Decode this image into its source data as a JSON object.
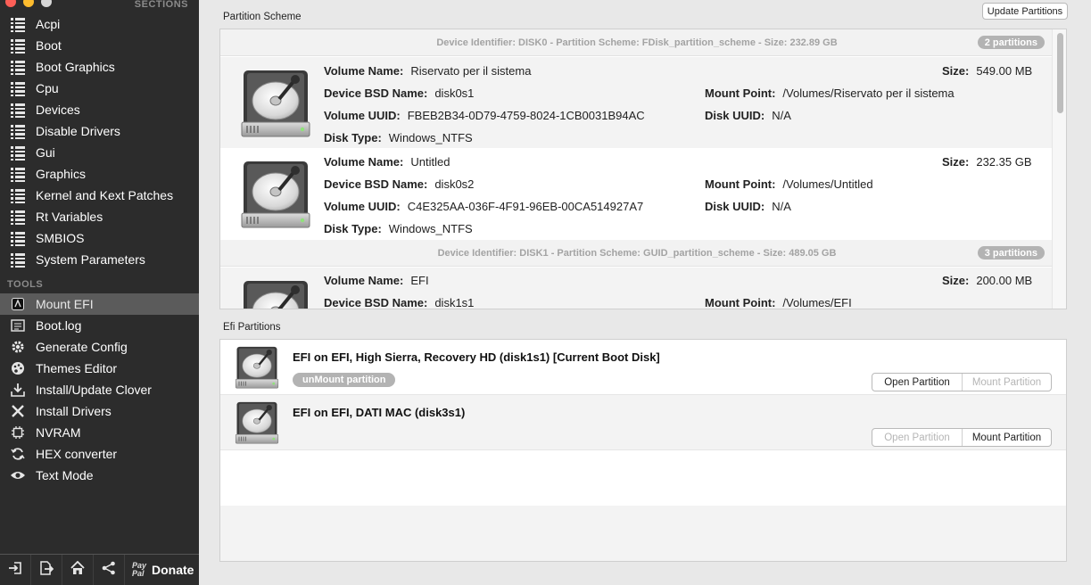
{
  "sidebar": {
    "sections_title": "SECTIONS",
    "section_items": [
      {
        "label": "Acpi"
      },
      {
        "label": "Boot"
      },
      {
        "label": "Boot Graphics"
      },
      {
        "label": "Cpu"
      },
      {
        "label": "Devices"
      },
      {
        "label": "Disable Drivers"
      },
      {
        "label": "Gui"
      },
      {
        "label": "Graphics"
      },
      {
        "label": "Kernel and Kext Patches"
      },
      {
        "label": "Rt Variables"
      },
      {
        "label": "SMBIOS"
      },
      {
        "label": "System Parameters"
      }
    ],
    "tools_title": "TOOLS",
    "tool_items": [
      {
        "label": "Mount EFI",
        "icon": "mount-efi-icon",
        "active": true
      },
      {
        "label": "Boot.log",
        "icon": "log-icon"
      },
      {
        "label": "Generate Config",
        "icon": "gear-icon"
      },
      {
        "label": "Themes Editor",
        "icon": "palette-icon"
      },
      {
        "label": "Install/Update Clover",
        "icon": "download-icon"
      },
      {
        "label": "Install Drivers",
        "icon": "tools-icon"
      },
      {
        "label": "NVRAM",
        "icon": "chip-icon"
      },
      {
        "label": "HEX converter",
        "icon": "refresh-icon"
      },
      {
        "label": "Text Mode",
        "icon": "eye-icon"
      }
    ],
    "footer": {
      "paypal_top": "Pay",
      "paypal_bottom": "Pal",
      "donate_label": "Donate"
    }
  },
  "partition_scheme": {
    "title": "Partition Scheme",
    "update_button": "Update Partitions",
    "labels": {
      "volume_name": "Volume Name:",
      "bsd_name": "Device BSD Name:",
      "volume_uuid": "Volume UUID:",
      "disk_type": "Disk Type:",
      "size": "Size:",
      "mount_point": "Mount Point:",
      "disk_uuid": "Disk UUID:"
    },
    "disk0": {
      "header": "Device Identifier: DISK0 - Partition Scheme: FDisk_partition_scheme - Size: 232.89 GB",
      "badge": "2 partitions",
      "partitions": [
        {
          "volume_name": "Riservato per il sistema",
          "bsd_name": "disk0s1",
          "volume_uuid": "FBEB2B34-0D79-4759-8024-1CB0031B94AC",
          "disk_type": "Windows_NTFS",
          "size": "549.00 MB",
          "mount_point": "/Volumes/Riservato per il sistema",
          "disk_uuid": "N/A"
        },
        {
          "volume_name": "Untitled",
          "bsd_name": "disk0s2",
          "volume_uuid": "C4E325AA-036F-4F91-96EB-00CA514927A7",
          "disk_type": "Windows_NTFS",
          "size": "232.35 GB",
          "mount_point": "/Volumes/Untitled",
          "disk_uuid": "N/A"
        }
      ]
    },
    "disk1": {
      "header": "Device Identifier: DISK1 - Partition Scheme: GUID_partition_scheme - Size: 489.05 GB",
      "badge": "3 partitions",
      "partitions": [
        {
          "volume_name": "EFI",
          "bsd_name": "disk1s1",
          "size": "200.00 MB",
          "mount_point": "/Volumes/EFI"
        }
      ]
    }
  },
  "efi_partitions": {
    "title": "Efi Partitions",
    "open_label": "Open Partition",
    "mount_label": "Mount Partition",
    "items": [
      {
        "title": "EFI on EFI, High Sierra, Recovery HD (disk1s1) [Current Boot Disk]",
        "unmount_label": "unMount partition"
      },
      {
        "title": "EFI on EFI, DATI MAC (disk3s1)"
      }
    ]
  }
}
